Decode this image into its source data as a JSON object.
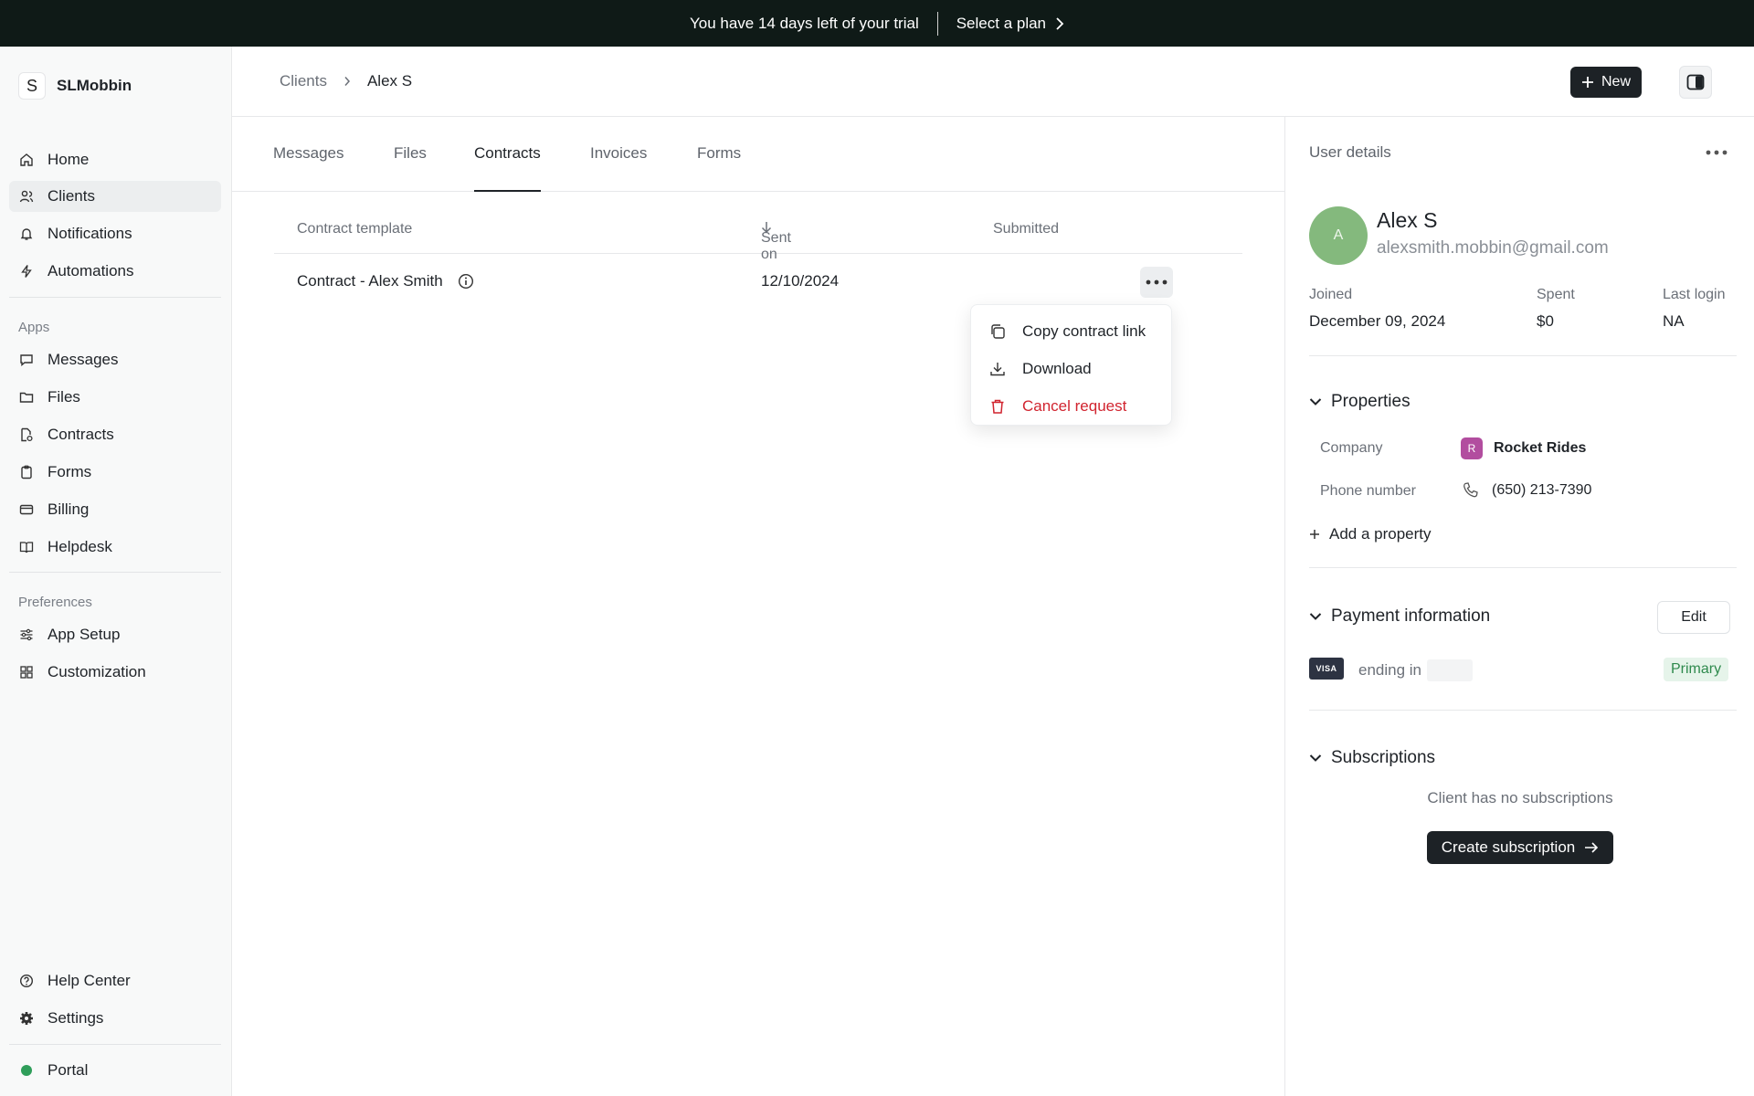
{
  "banner": {
    "trial_text": "You have 14 days left of your trial",
    "plan_label": "Select a plan"
  },
  "sidebar": {
    "brand_initial": "S",
    "brand_name": "SLMobbin",
    "main_items": [
      {
        "label": "Home",
        "icon": "home-icon"
      },
      {
        "label": "Clients",
        "icon": "users-icon",
        "active": true
      },
      {
        "label": "Notifications",
        "icon": "bell-icon"
      },
      {
        "label": "Automations",
        "icon": "bolt-icon"
      }
    ],
    "apps_label": "Apps",
    "app_items": [
      {
        "label": "Messages",
        "icon": "message-icon"
      },
      {
        "label": "Files",
        "icon": "folder-icon"
      },
      {
        "label": "Contracts",
        "icon": "contract-icon"
      },
      {
        "label": "Forms",
        "icon": "clipboard-icon"
      },
      {
        "label": "Billing",
        "icon": "card-icon"
      },
      {
        "label": "Helpdesk",
        "icon": "book-icon"
      }
    ],
    "preferences_label": "Preferences",
    "pref_items": [
      {
        "label": "App Setup",
        "icon": "sliders-icon"
      },
      {
        "label": "Customization",
        "icon": "grid-icon"
      }
    ],
    "help_center": "Help Center",
    "settings": "Settings",
    "portal": "Portal"
  },
  "header": {
    "breadcrumb_parent": "Clients",
    "breadcrumb_current": "Alex S",
    "new_button": "New"
  },
  "tabs": [
    "Messages",
    "Files",
    "Contracts",
    "Invoices",
    "Forms"
  ],
  "active_tab": "Contracts",
  "table": {
    "columns": [
      "Contract template",
      "Sent on",
      "Submitted"
    ],
    "rows": [
      {
        "template": "Contract - Alex Smith",
        "sent_on": "12/10/2024",
        "submitted": ""
      }
    ]
  },
  "row_menu": {
    "copy": "Copy contract link",
    "download": "Download",
    "cancel": "Cancel request",
    "danger_color": "#d1242f"
  },
  "user_panel": {
    "title": "User details",
    "avatar_initial": "A",
    "name": "Alex S",
    "email": "alexsmith.mobbin@gmail.com",
    "stats": {
      "joined_label": "Joined",
      "joined_value": "December 09, 2024",
      "spent_label": "Spent",
      "spent_value": "$0",
      "last_login_label": "Last login",
      "last_login_value": "NA"
    },
    "properties": {
      "heading": "Properties",
      "company_label": "Company",
      "company_initial": "R",
      "company_value": "Rocket Rides",
      "phone_label": "Phone number",
      "phone_value": "(650) 213-7390",
      "add_label": "Add a property"
    },
    "payment": {
      "heading": "Payment information",
      "edit_label": "Edit",
      "card_brand": "VISA",
      "ending_label": "ending in",
      "badge": "Primary"
    },
    "subscriptions": {
      "heading": "Subscriptions",
      "empty_text": "Client has no subscriptions",
      "create_label": "Create subscription"
    }
  }
}
